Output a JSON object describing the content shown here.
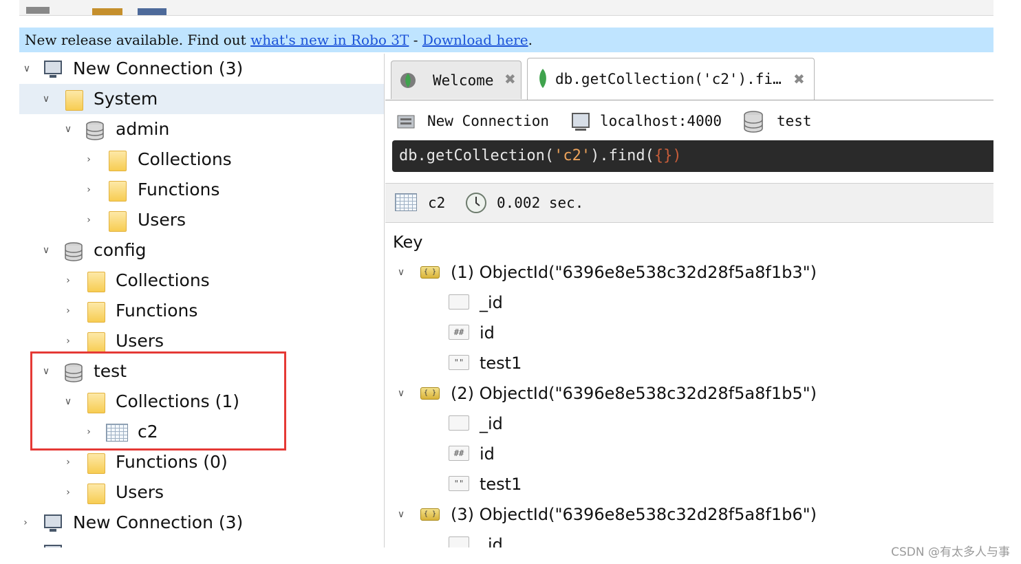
{
  "toolbar": {
    "icons": [
      "connect-icon",
      "open-shell-icon",
      "monitor-icon"
    ]
  },
  "banner": {
    "text_start": "New release available. Find out ",
    "whats_new_link": "what's new in Robo 3T",
    "separator": " - ",
    "download_link": "Download here",
    "text_end": "."
  },
  "tree": {
    "connection1": "New Connection (3)",
    "system": "System",
    "admin": "admin",
    "admin_collections": "Collections",
    "admin_functions": "Functions",
    "admin_users": "Users",
    "config": "config",
    "config_collections": "Collections",
    "config_functions": "Functions",
    "config_users": "Users",
    "test": "test",
    "test_collections": "Collections (1)",
    "test_c2": "c2",
    "test_functions": "Functions (0)",
    "test_users": "Users",
    "connection2": "New Connection (3)"
  },
  "tabs": [
    {
      "label": "Welcome",
      "icon": "leaf-icon"
    },
    {
      "label": "db.getCollection('c2').fi…",
      "icon": "leaf-icon"
    }
  ],
  "connection_info": {
    "name": "New Connection",
    "host": "localhost:4000",
    "database": "test"
  },
  "query": {
    "prefix": "db.getCollection(",
    "arg": "'c2'",
    "middle": ").find(",
    "braces": "{}",
    "suffix": ")"
  },
  "result_bar": {
    "collection": "c2",
    "time": "0.002 sec."
  },
  "results": {
    "header": "Key",
    "docs": [
      {
        "label": "(1) ObjectId(\"6396e8e538c32d28f5a8f1b3\")",
        "fields": [
          "_id",
          "id",
          "test1"
        ]
      },
      {
        "label": "(2) ObjectId(\"6396e8e538c32d28f5a8f1b5\")",
        "fields": [
          "_id",
          "id",
          "test1"
        ]
      },
      {
        "label": "(3) ObjectId(\"6396e8e538c32d28f5a8f1b6\")",
        "fields": [
          "_id"
        ]
      }
    ],
    "field_icon_text": {
      "objectid": "",
      "number": "##",
      "string": "\"\""
    }
  },
  "colors": {
    "banner": "#bfe4ff",
    "link": "#1b52d8",
    "highlight": "#e53935",
    "query_bg": "#2a2a2a"
  },
  "watermark": "CSDN @有太多人与事"
}
